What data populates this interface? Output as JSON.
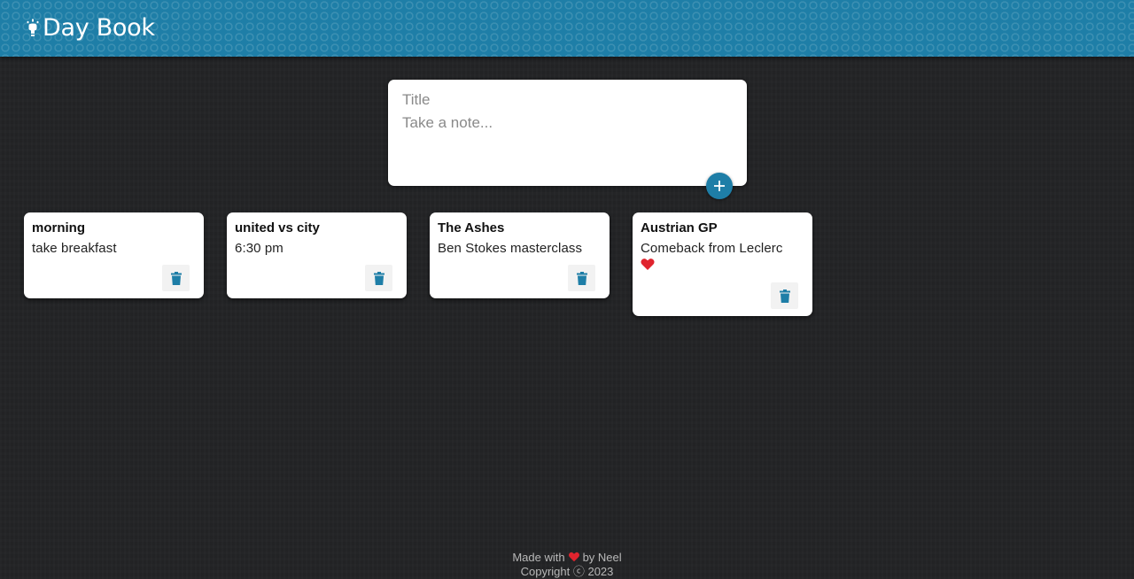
{
  "header": {
    "title": "Day Book",
    "icon": "lightbulb-icon",
    "background_color": "#1e7ea7"
  },
  "create_note": {
    "title_placeholder": "Title",
    "content_placeholder": "Take a note...",
    "add_icon": "plus-icon"
  },
  "notes": [
    {
      "title": "morning",
      "content": "take breakfast"
    },
    {
      "title": "united vs city",
      "content": "6:30 pm"
    },
    {
      "title": "The Ashes",
      "content": "Ben Stokes masterclass"
    },
    {
      "title": "Austrian GP",
      "content": "Comeback from Leclerc"
    }
  ],
  "delete_icon": "trash-icon",
  "footer": {
    "made_with": "Made with",
    "by": "by Neel",
    "copyright": "Copyright ⓒ 2023"
  },
  "colors": {
    "accent": "#1e7ea7",
    "heart": "#e0242e",
    "background": "#232426"
  }
}
